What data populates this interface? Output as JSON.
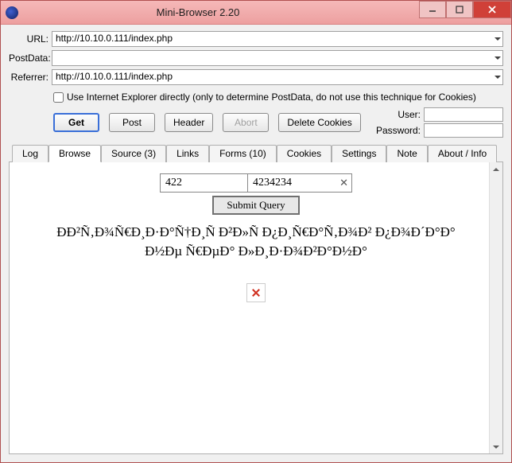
{
  "window": {
    "title": "Mini-Browser 2.20"
  },
  "form": {
    "url_label": "URL:",
    "url_value": "http://10.10.0.111/index.php",
    "postdata_label": "PostData:",
    "postdata_value": "",
    "referrer_label": "Referrer:",
    "referrer_value": "http://10.10.0.111/index.php",
    "ie_checkbox_label": "Use Internet Explorer directly (only to determine PostData, do not use this technique for Cookies)"
  },
  "buttons": {
    "get": "Get",
    "post": "Post",
    "header": "Header",
    "abort": "Abort",
    "delete_cookies": "Delete Cookies"
  },
  "creds": {
    "user_label": "User:",
    "user_value": "",
    "password_label": "Password:",
    "password_value": ""
  },
  "tabs": {
    "log": "Log",
    "browse": "Browse",
    "source": "Source (3)",
    "links": "Links",
    "forms": "Forms (10)",
    "cookies": "Cookies",
    "settings": "Settings",
    "note": "Note",
    "about": "About / Info"
  },
  "page": {
    "input1": "422",
    "input2": "4234234",
    "submit_label": "Submit Query",
    "text": "ÐÐ²Ñ‚Ð¾Ñ€Ð¸Ð·Ð°Ñ†Ð¸Ñ Ð²Ð»Ñ Ð¿Ð¸Ñ€Ð°Ñ‚Ð¾Ð² Ð¿Ð¾Ð´Ð°Ð° Ð½Ðµ Ñ€ÐµÐ° Ð»Ð¸Ð·Ð¾Ð²Ð°Ð½Ð°"
  }
}
